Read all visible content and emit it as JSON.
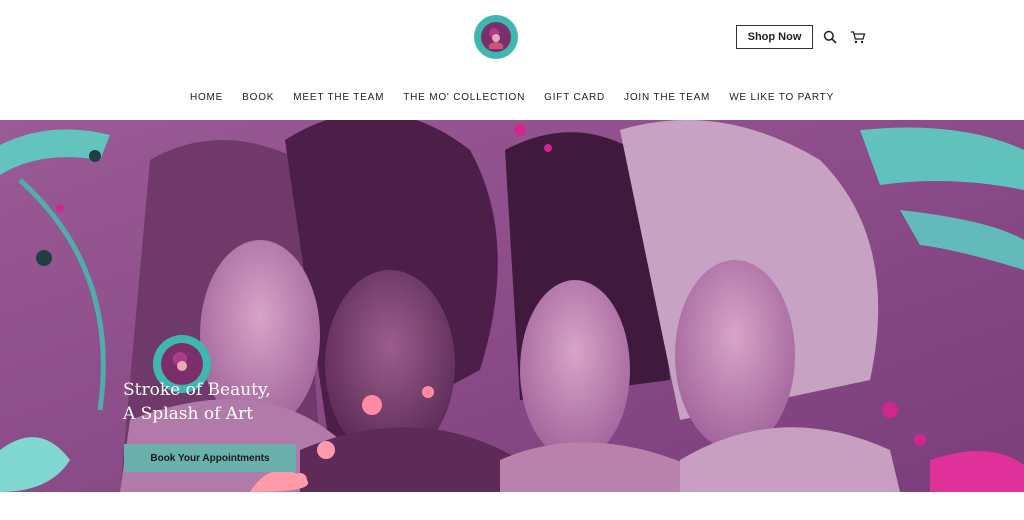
{
  "header": {
    "logo_icon": "circular-salon-logo",
    "shop_label": "Shop Now",
    "search_icon": "search-icon",
    "cart_icon": "cart-icon"
  },
  "nav": {
    "items": [
      {
        "label": "HOME"
      },
      {
        "label": "BOOK"
      },
      {
        "label": "MEET THE TEAM"
      },
      {
        "label": "THE MO' COLLECTION"
      },
      {
        "label": "GIFT CARD"
      },
      {
        "label": "JOIN THE TEAM"
      },
      {
        "label": "WE LIKE TO PARTY"
      }
    ]
  },
  "hero": {
    "title_line1": "Stroke of Beauty,",
    "title_line2": "A Splash of Art",
    "cta_label": "Book Your Appointments",
    "image": "four women portrait with purple tint and paint splashes",
    "colors": {
      "tint": "#8a4f89",
      "teal": "#5ccfc3",
      "pink": "#ff8aa2",
      "magenta": "#d0268d",
      "button": "#6bb0ad"
    }
  }
}
